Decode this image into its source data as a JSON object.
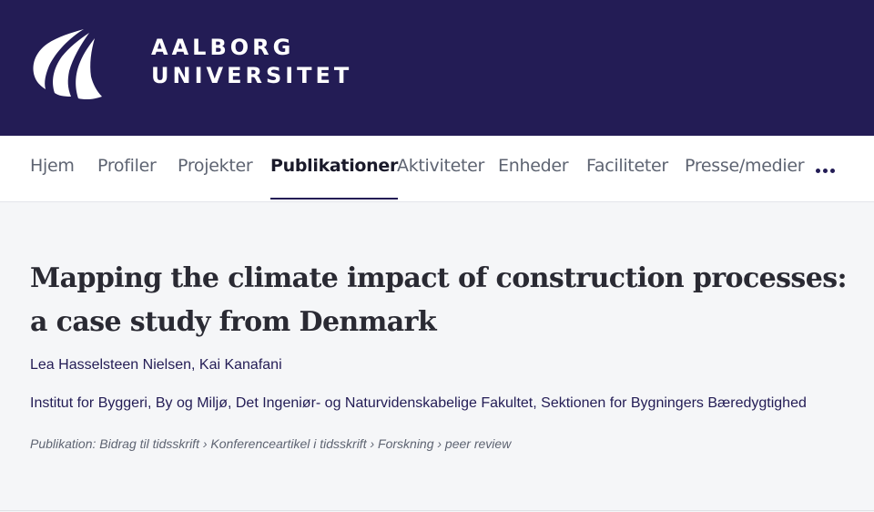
{
  "header": {
    "logo_line1": "AALBORG",
    "logo_line2": "UNIVERSITET",
    "background_color": "#231c55"
  },
  "nav": {
    "items": [
      {
        "label": "Hjem"
      },
      {
        "label": "Profiler"
      },
      {
        "label": "Projekter"
      },
      {
        "label": "Publikationer",
        "active": true
      },
      {
        "label": "Aktiviteter"
      },
      {
        "label": "Enheder"
      },
      {
        "label": "Faciliteter"
      },
      {
        "label": "Presse/medier"
      }
    ],
    "more_icon": "more-horizontal-icon"
  },
  "publication": {
    "title": "Mapping the climate impact of construction processes: a case study from Denmark",
    "authors": [
      "Lea Hasselsteen Nielsen",
      "Kai Kanafani"
    ],
    "author_separator": ", ",
    "organisations": [
      "Institut for Byggeri, By og Miljø",
      "Det Ingeniør- og Naturvidenskabelige Fakultet",
      "Sektionen for Bygningers Bæredygtighed"
    ],
    "organisation_separator": ", ",
    "classification": "Publikation: Bidrag til tidsskrift › Konferenceartikel i tidsskrift › Forskning › peer review"
  }
}
